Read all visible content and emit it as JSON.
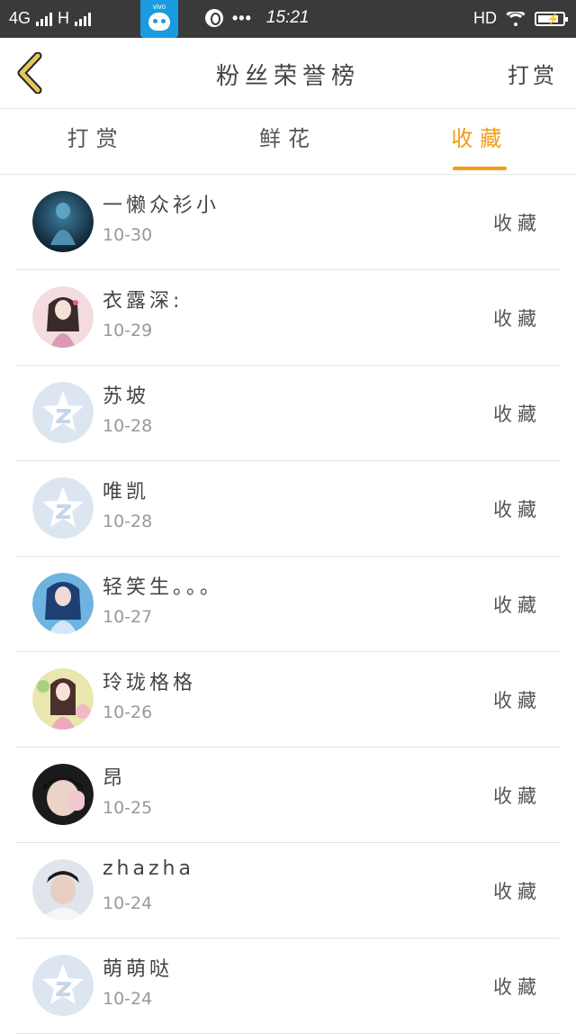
{
  "statusbar": {
    "network": "4G",
    "network2": "H",
    "app_tag": "vivo",
    "dots": "•••",
    "time": "15:21",
    "hd": "HD",
    "battery_level": 0.85
  },
  "header": {
    "title": "粉丝荣誉榜",
    "action": "打赏"
  },
  "tabs": [
    {
      "label": "打赏",
      "active": false
    },
    {
      "label": "鲜花",
      "active": false
    },
    {
      "label": "收藏",
      "active": true
    }
  ],
  "colors": {
    "accent": "#f39c12",
    "statusbar": "#3a3a3a",
    "back_chevron": "#d4b84a"
  },
  "list": [
    {
      "name": "一懒众衫小",
      "date": "10-30",
      "type": "收藏",
      "avatar": "dark-blue-figure"
    },
    {
      "name": "衣露深:",
      "date": "10-29",
      "type": "收藏",
      "avatar": "anime-girl-pink"
    },
    {
      "name": "苏坡",
      "date": "10-28",
      "type": "收藏",
      "avatar": "default-qq"
    },
    {
      "name": "唯凯",
      "date": "10-28",
      "type": "收藏",
      "avatar": "default-qq"
    },
    {
      "name": "轻笑生。。。",
      "date": "10-27",
      "type": "收藏",
      "avatar": "anime-girl-blue"
    },
    {
      "name": "玲珑格格",
      "date": "10-26",
      "type": "收藏",
      "avatar": "anime-girl-flowers"
    },
    {
      "name": "昂",
      "date": "10-25",
      "type": "收藏",
      "avatar": "photo-person"
    },
    {
      "name": "zhazha",
      "date": "10-24",
      "type": "收藏",
      "avatar": "photo-person-light"
    },
    {
      "name": "萌萌哒",
      "date": "10-24",
      "type": "收藏",
      "avatar": "default-qq"
    }
  ]
}
